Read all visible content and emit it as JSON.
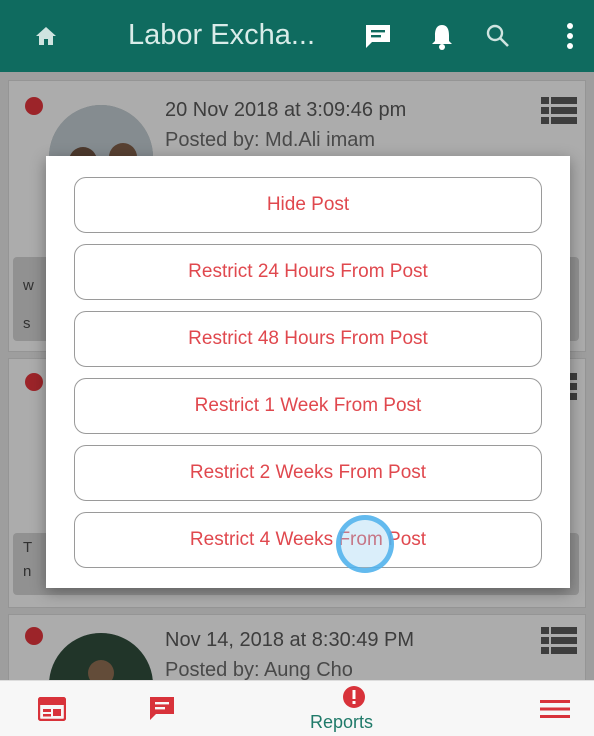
{
  "appbar": {
    "title": "Labor Excha...",
    "home_icon": "home-icon",
    "chat_icon": "chat-icon",
    "bell_icon": "bell-icon",
    "search_icon": "search-icon",
    "more_icon": "more-vert-icon",
    "color": "#0f6b5f"
  },
  "feed": {
    "posts": [
      {
        "date": "20 Nov 2018 at 3:09:46 pm",
        "author": "Posted by: Md.Ali imam"
      },
      {
        "date": "",
        "author": ""
      },
      {
        "date": "Nov 14, 2018 at 8:30:49 PM",
        "author": "Posted by: Aung Cho"
      }
    ],
    "fragments": [
      "w",
      "s",
      "T",
      "n"
    ]
  },
  "dialog": {
    "options": [
      "Hide Post",
      "Restrict 24 Hours From Post",
      "Restrict 48 Hours From Post",
      "Restrict 1 Week From Post",
      "Restrict 2 Weeks From Post",
      "Restrict 4 Weeks From Post"
    ],
    "option_color": "#e0484e"
  },
  "bottomnav": {
    "items": [
      {
        "icon": "calendar-icon"
      },
      {
        "icon": "chat-icon"
      },
      {
        "icon": "alert-icon",
        "label": "Reports"
      },
      {
        "icon": "menu-icon"
      }
    ],
    "active_color": "#1f7a69"
  }
}
